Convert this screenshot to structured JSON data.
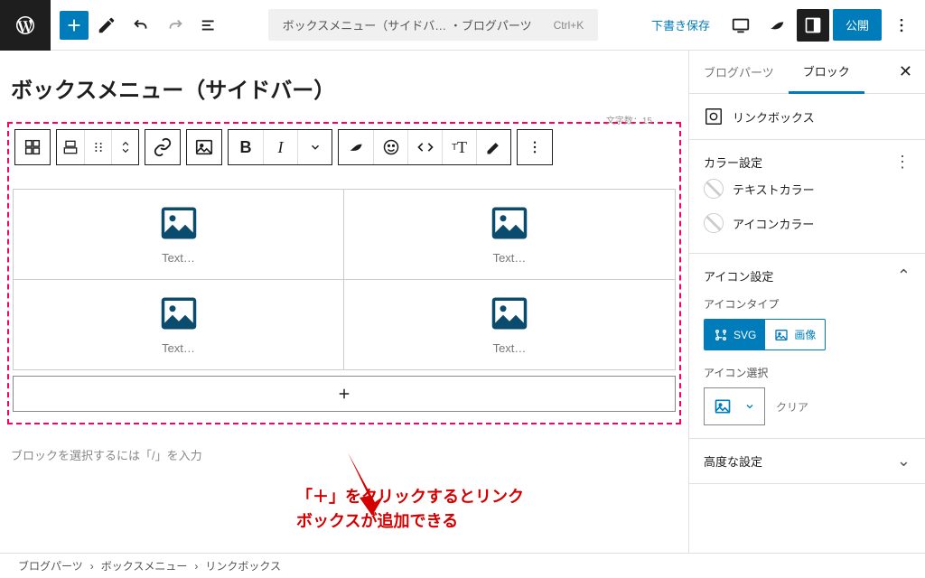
{
  "topbar": {
    "doc_title": "ボックスメニュー（サイドバ… ・ブログパーツ",
    "shortcut": "Ctrl+K",
    "save_draft": "下書き保存",
    "publish": "公開"
  },
  "editor": {
    "page_title": "ボックスメニュー（サイドバー）",
    "char_count": "文字数：15",
    "grid_cells": [
      {
        "text": "Text…"
      },
      {
        "text": "Text…"
      },
      {
        "text": "Text…"
      },
      {
        "text": "Text…"
      }
    ],
    "placeholder": "ブロックを選択するには「/」を入力",
    "annotation_l1": "「＋」をクリックするとリンク",
    "annotation_l2": "ボックスが追加できる"
  },
  "sidebar": {
    "tabs": {
      "parts": "ブログパーツ",
      "block": "ブロック"
    },
    "block_name": "リンクボックス",
    "sections": {
      "color": {
        "title": "カラー設定",
        "text_color": "テキストカラー",
        "icon_color": "アイコンカラー"
      },
      "icon": {
        "title": "アイコン設定",
        "type_label": "アイコンタイプ",
        "svg": "SVG",
        "image": "画像",
        "select_label": "アイコン選択",
        "clear": "クリア"
      },
      "advanced": {
        "title": "高度な設定"
      }
    }
  },
  "breadcrumb": {
    "a": "ブログパーツ",
    "b": "ボックスメニュー",
    "c": "リンクボックス"
  }
}
